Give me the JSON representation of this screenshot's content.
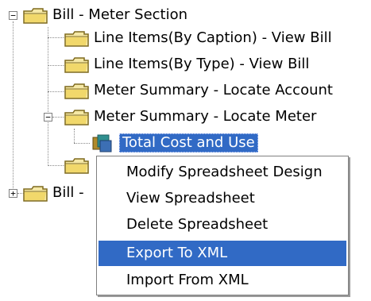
{
  "tree": {
    "root_expanded": {
      "label": "Bill - Meter Section",
      "expander": "−",
      "children": [
        {
          "label": "Line Items(By Caption) - View Bill"
        },
        {
          "label": "Line Items(By Type) - View Bill"
        },
        {
          "label": "Meter Summary - Locate Account"
        },
        {
          "label": "Meter Summary - Locate Meter",
          "expander": "−",
          "children": [
            {
              "label": "Total Cost and Use",
              "selected": true
            }
          ]
        }
      ]
    },
    "root_collapsed": {
      "label": "Bill - ",
      "expander": "+"
    }
  },
  "context_menu": {
    "items": [
      {
        "label": "Modify Spreadsheet Design"
      },
      {
        "label": "View Spreadsheet"
      },
      {
        "label": "Delete Spreadsheet"
      },
      {
        "label": "Export To XML",
        "highlighted": true
      },
      {
        "label": "Import From XML"
      }
    ]
  },
  "colors": {
    "selection": "#316ac5",
    "folder_fill": "#f5e8a6",
    "folder_edge": "#7f6a1f"
  }
}
